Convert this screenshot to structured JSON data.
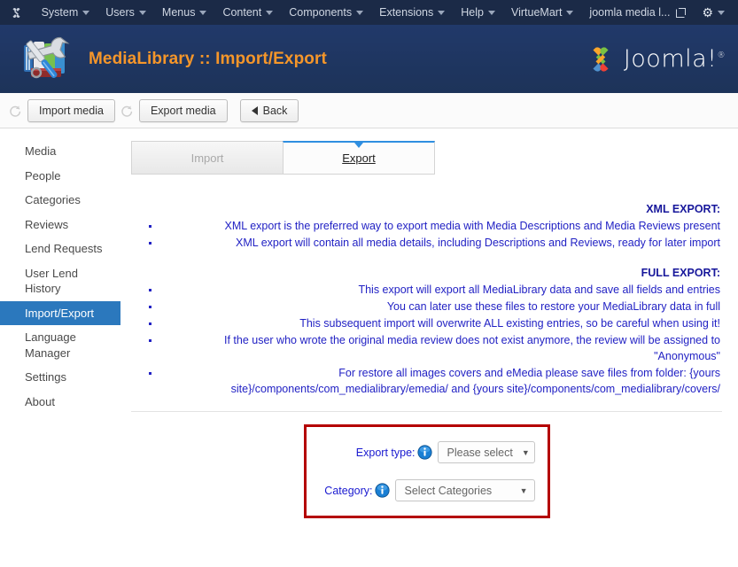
{
  "admin_bar": {
    "brand_icon": "joomla-brand-icon",
    "menus": [
      {
        "label": "System",
        "caret": true
      },
      {
        "label": "Users",
        "caret": true
      },
      {
        "label": "Menus",
        "caret": true
      },
      {
        "label": "Content",
        "caret": true
      },
      {
        "label": "Components",
        "caret": true
      },
      {
        "label": "Extensions",
        "caret": true
      },
      {
        "label": "Help",
        "caret": true
      },
      {
        "label": "VirtueMart",
        "caret": true
      }
    ],
    "site_name": "joomla media l...",
    "site_link_icon": "external-link-icon",
    "gear_icon": "gear-icon",
    "gear_caret": true
  },
  "header": {
    "icon": "tools-icon",
    "title": "MediaLibrary :: Import/Export",
    "title_color": "#f5962a",
    "band_color": "#1f3864",
    "logo_text": "Joomla!",
    "logo_sup": "®"
  },
  "toolbar": {
    "buttons": [
      {
        "label": "Import media",
        "icon": "loop-arrow-icon"
      },
      {
        "label": "Export media",
        "icon": "loop-arrow-icon"
      }
    ],
    "back_label": "Back",
    "back_icon": "chevron-left-icon"
  },
  "sidebar": {
    "items": [
      {
        "label": "Media",
        "active": false
      },
      {
        "label": "People",
        "active": false
      },
      {
        "label": "Categories",
        "active": false
      },
      {
        "label": "Reviews",
        "active": false
      },
      {
        "label": "Lend Requests",
        "active": false
      },
      {
        "label": "User Lend History",
        "active": false
      },
      {
        "label": "Import/Export",
        "active": true
      },
      {
        "label": "Language Manager",
        "active": false
      },
      {
        "label": "Settings",
        "active": false
      },
      {
        "label": "About",
        "active": false
      }
    ],
    "active_color": "#2b78bd"
  },
  "tabs": [
    {
      "label": "Import",
      "active": false
    },
    {
      "label": "Export",
      "active": true
    }
  ],
  "tab_accent_color": "#2f8ee0",
  "info": {
    "xml_heading": "XML EXPORT:",
    "xml_bullets": [
      "XML export is the preferred way to export media with Media Descriptions and Media Reviews present",
      "XML export will contain all media details, including Descriptions and Reviews, ready for later import"
    ],
    "full_heading": "FULL EXPORT:",
    "full_bullets": [
      "This export will export all MediaLibrary data and save all fields and entries",
      "You can later use these files to restore your MediaLibrary data in full",
      "This subsequent import will overwrite ALL existing entries, so be careful when using it!",
      "If the user who wrote the original media review does not exist anymore, the review will be assigned to \"Anonymous\"",
      "For restore all images covers and eMedia please save files from folder: {yours site}/components/com_medialibrary/emedia/ and {yours site}/components/com_medialibrary/covers/"
    ],
    "text_color": "#2222c4",
    "heading_color": "#17179b"
  },
  "form": {
    "border_color": "#b40000",
    "export_type": {
      "label": "Export type:",
      "info_icon": "info-circle-icon",
      "value": "Please select",
      "caret": "▼"
    },
    "category": {
      "label": "Category:",
      "info_icon": "info-circle-icon",
      "value": "Select Categories",
      "caret": "▼"
    }
  }
}
